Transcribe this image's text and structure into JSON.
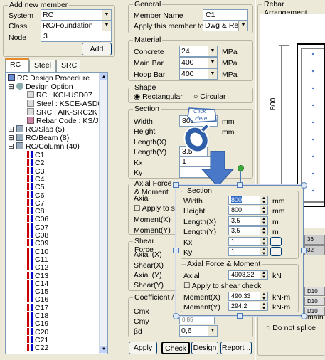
{
  "add_member": {
    "title": "Add new member",
    "system_label": "System",
    "system_value": "RC",
    "class_label": "Class",
    "class_value": "RC/Foundation",
    "node_label": "Node",
    "node_value": "3",
    "add_button": "Add"
  },
  "tabs": [
    "RC",
    "Steel",
    "SRC"
  ],
  "tree": {
    "root": "RC Design Procedure",
    "design_option": "Design Option",
    "options": [
      "RC : KCI-USD07",
      "Steel : KSCE-ASD05",
      "SRC : AIK-SRC2K",
      "Rebar Code : KS/JIS"
    ],
    "slab": "RC/Slab (5)",
    "beam": "RC/Beam (8)",
    "column": "RC/Column (40)",
    "columns": [
      "C1",
      "C2",
      "C3",
      "C4",
      "C5",
      "C6",
      "C7",
      "C8",
      "C06",
      "C07",
      "C08",
      "C09",
      "C10",
      "C11",
      "C12",
      "C13",
      "C14",
      "C15",
      "C16",
      "C17",
      "C18",
      "C19",
      "C20",
      "C21",
      "C22"
    ]
  },
  "general": {
    "title": "General",
    "member_name_label": "Member Name",
    "member_name_value": "C1",
    "apply_label": "Apply this member to",
    "apply_value": "Dwg & Rep"
  },
  "material": {
    "title": "Material",
    "concrete_label": "Concrete",
    "concrete_value": "24",
    "main_bar_label": "Main Bar",
    "main_bar_value": "400",
    "hoop_bar_label": "Hoop Bar",
    "hoop_bar_value": "400",
    "unit": "MPa"
  },
  "shape": {
    "title": "Shape",
    "rect_label": "Rectangular",
    "circ_label": "Circular"
  },
  "section_bg": {
    "title": "Section",
    "width_label": "Width",
    "width_value": "800",
    "height_label": "Height",
    "height_value": "800",
    "lengthx_label": "Length(X)",
    "lengthx_value": "3.5",
    "lengthy_label": "Length(Y)",
    "lengthy_value": "3.5",
    "kx_label": "Kx",
    "kx_value": "1",
    "ky_label": "Ky",
    "ky_value": "1",
    "unit_mm": "mm",
    "unit_m": "m"
  },
  "axial_bg": {
    "title": "Axial Force & Moment",
    "axial_label": "Axial",
    "apply_shear_label": "Apply to sha",
    "mx_label": "Moment(X)",
    "my_label": "Moment(Y)"
  },
  "shear_bg": {
    "title": "Shear Force",
    "axial_x": "Axial (X)",
    "shear_x": "Shear(X)",
    "axial_y": "Axial (Y)",
    "shear_y": "Shear(Y)"
  },
  "coef_bg": {
    "title": "Coefficient / F",
    "cmx": "Cmx",
    "cmy": "Cmy",
    "bd": "βd",
    "bd_value": "0,6",
    "cmy_value": "0,85"
  },
  "bottom_buttons": [
    "Apply",
    "Check",
    "Design",
    "Report .."
  ],
  "rebar": {
    "title": "Rebar Arrangement",
    "dim_label": "800",
    "side_values": [
      "36",
      "32"
    ],
    "d_labels": [
      "D10",
      "D10",
      "D10"
    ],
    "main_label": "main",
    "splice_label": "Do not splice"
  },
  "callout": {
    "line1": "Click",
    "line2": "Here"
  },
  "overlay": {
    "section_title": "Section",
    "width_label": "Width",
    "width_value": "800",
    "height_label": "Height",
    "height_value": "800",
    "lengthx_label": "Length(X)",
    "lengthx_value": "3,5",
    "lengthy_label": "Length(Y)",
    "lengthy_value": "3,5",
    "kx_label": "Kx",
    "kx_value": "1",
    "ky_label": "Ky",
    "ky_value": "1",
    "unit_mm": "mm",
    "unit_m": "m",
    "more_btn": "...",
    "axial_title": "Axial Force & Moment",
    "axial_label": "Axial",
    "axial_value": "4903,32",
    "axial_unit": "kN",
    "apply_shear_label": "Apply to shear check",
    "mx_label": "Moment(X)",
    "mx_value": "490,33",
    "my_label": "Moment(Y)",
    "my_value": "294,2",
    "moment_unit": "kN·m"
  },
  "colors": {
    "accent": "#316ac5",
    "arrow": "#4a78c8",
    "green_handle": "#3aa83a"
  }
}
